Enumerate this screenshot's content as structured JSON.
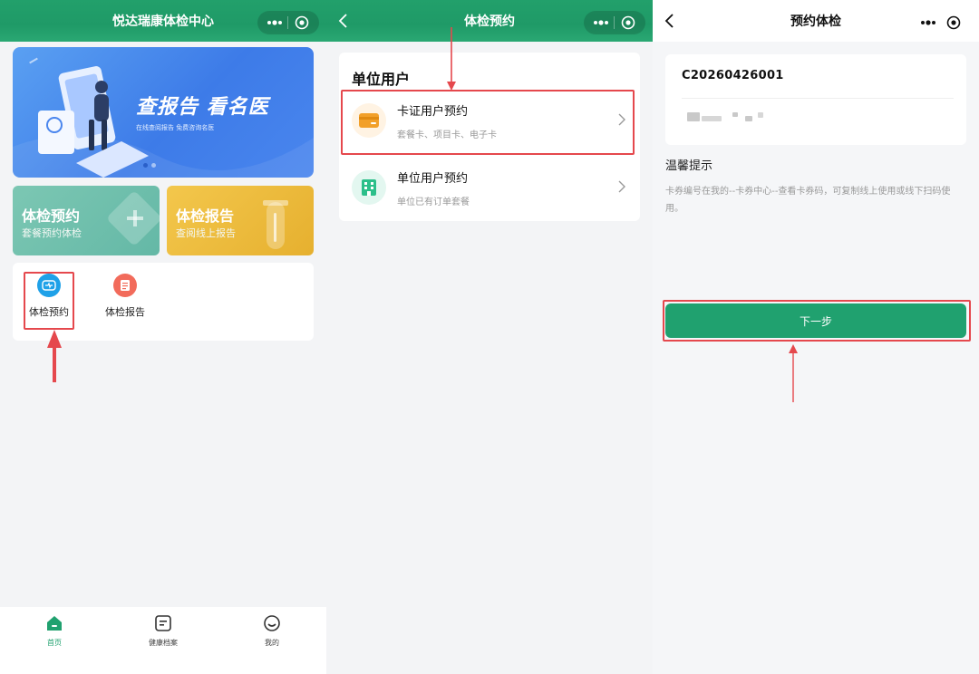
{
  "colors": {
    "brand_green": "#20a16f",
    "highlight_red": "#e5484d"
  },
  "screen1": {
    "nav_title": "悦达瑞康体检中心",
    "banner": {
      "title": "查报告 看名医",
      "subtitle": "在线查阅报告 免费咨询名医"
    },
    "cards": [
      {
        "title": "体检预约",
        "subtitle": "套餐预约体检"
      },
      {
        "title": "体检报告",
        "subtitle": "查阅线上报告"
      }
    ],
    "quick": [
      {
        "label": "体检预约"
      },
      {
        "label": "体检报告"
      }
    ],
    "tabs": [
      {
        "label": "首页",
        "icon": "home-icon"
      },
      {
        "label": "健康档案",
        "icon": "record-icon"
      },
      {
        "label": "我的",
        "icon": "profile-icon"
      }
    ]
  },
  "screen2": {
    "nav_title": "体检预约",
    "section_title": "单位用户",
    "rows": [
      {
        "title": "卡证用户预约",
        "subtitle": "套餐卡、项目卡、电子卡",
        "icon": "card-icon"
      },
      {
        "title": "单位用户预约",
        "subtitle": "单位已有订单套餐",
        "icon": "building-icon"
      }
    ]
  },
  "screen3": {
    "nav_title": "预约体检",
    "card_code": "C20260426001",
    "tips_title": "温馨提示",
    "tips_text": "卡券编号在我的--卡券中心--查看卡券码，可复制线上使用或线下扫码使用。",
    "next_button": "下一步"
  }
}
